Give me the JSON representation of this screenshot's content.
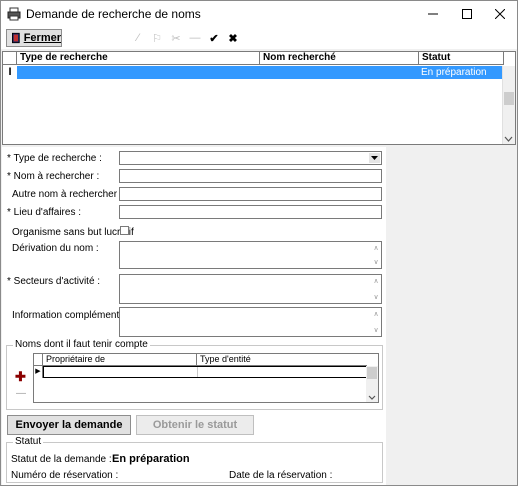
{
  "window": {
    "title": "Demande de recherche de noms",
    "app_icon": "printer-icon"
  },
  "controls": {
    "minimize_icon": "minimize-icon",
    "maximize_icon": "maximize-icon",
    "close_icon": "close-icon"
  },
  "toolbar": {
    "close_label": "Fermer",
    "icons": [
      "line-icon",
      "flag-icon",
      "scissors-icon",
      "minus-icon",
      "check-icon",
      "cross-icon"
    ]
  },
  "top_grid": {
    "columns": [
      "Type de recherche",
      "Nom recherché",
      "Statut"
    ],
    "rows": [
      {
        "type": "",
        "name": "",
        "status": "En préparation"
      }
    ],
    "row_marker": "I"
  },
  "form": {
    "type_label": "* Type de recherche :",
    "type_value": "",
    "name_label": "* Nom à rechercher :",
    "name_value": "",
    "alt_name_label": "Autre nom à rechercher :",
    "alt_name_value": "",
    "place_label": "* Lieu d'affaires :",
    "place_value": "",
    "nonprofit_label": "Organisme sans but lucratif",
    "nonprofit_checked": false,
    "derivation_label": "Dérivation du nom :",
    "sectors_label": "* Secteurs d'activité :",
    "info_label": "Information complémentaire :"
  },
  "names_group": {
    "title": "Noms dont il faut tenir compte",
    "columns": [
      "Propriétaire de",
      "Type d'entité"
    ],
    "add_icon": "plus-icon",
    "remove_icon": "minus-icon",
    "row_marker": "▶"
  },
  "actions": {
    "send_label": "Envoyer la demande",
    "status_label": "Obtenir le statut"
  },
  "status_group": {
    "title": "Statut",
    "request_status_label": "Statut de la demande :",
    "request_status_value": "En préparation",
    "reservation_number_label": "Numéro de réservation :",
    "reservation_date_label": "Date de la réservation :"
  },
  "colors": {
    "selection": "#3399ff",
    "window_bg": "#f0f0f0",
    "button_bg": "#e1e1e1"
  }
}
